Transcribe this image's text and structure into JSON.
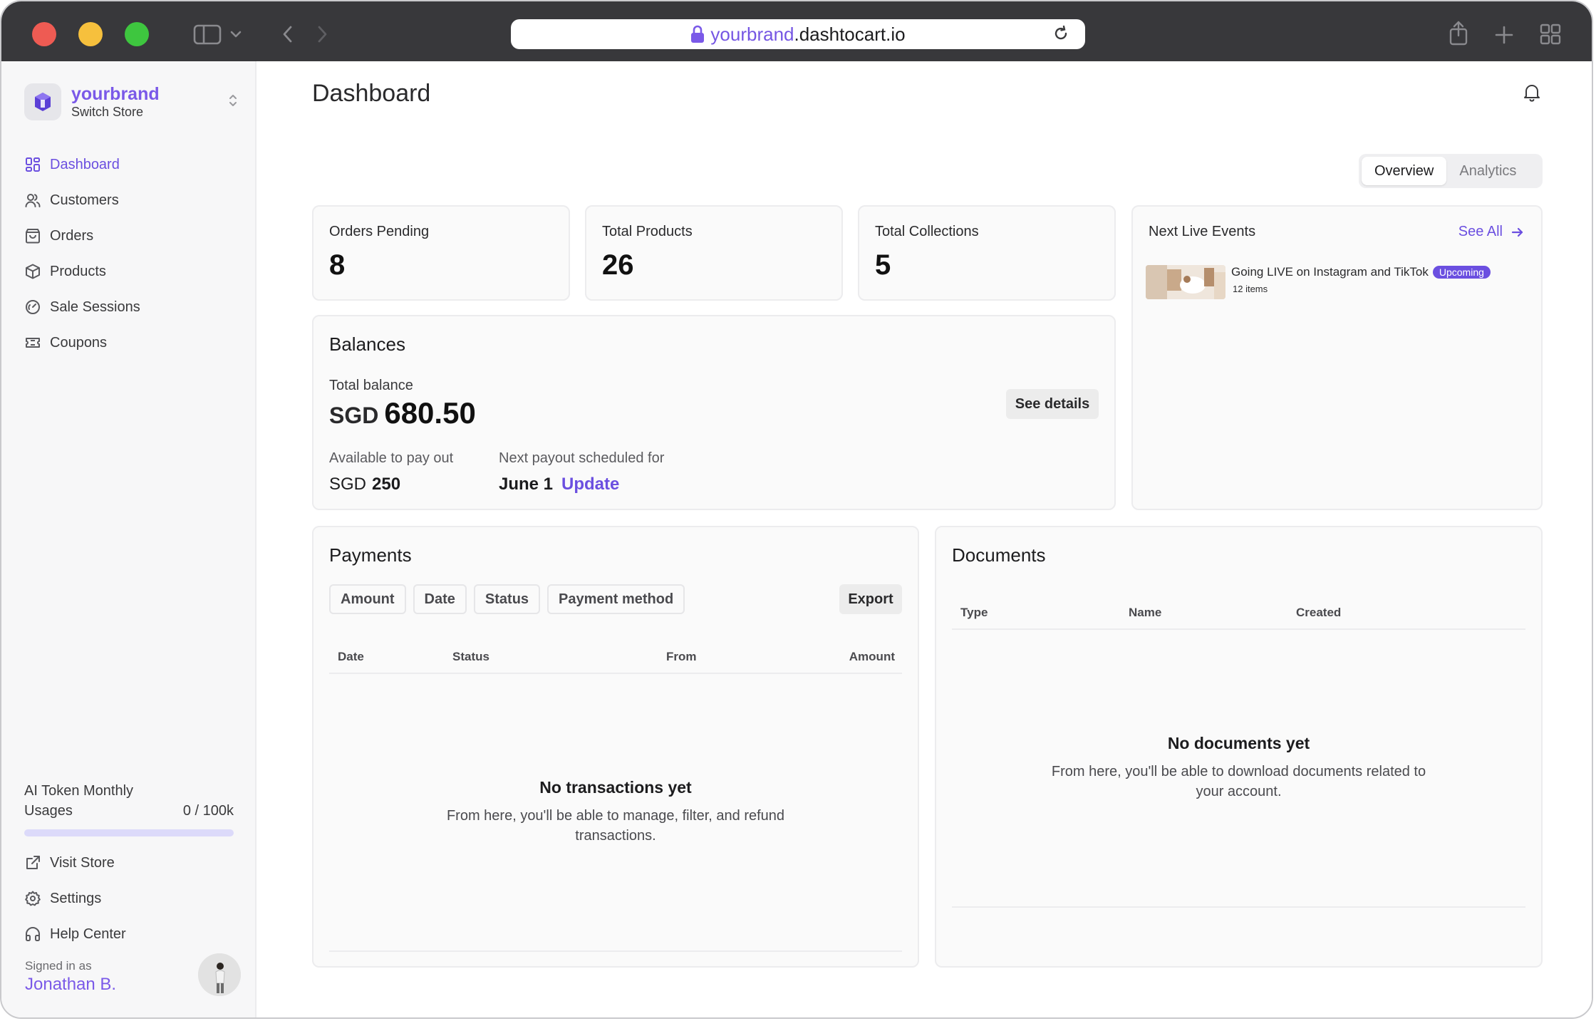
{
  "browser": {
    "url_subdomain": "yourbrand",
    "url_domain": ".dashtocart.io"
  },
  "sidebar": {
    "store_name": "yourbrand",
    "store_switch_label": "Switch Store",
    "nav": [
      {
        "label": "Dashboard",
        "icon": "dashboard-grid-icon",
        "active": true
      },
      {
        "label": "Customers",
        "icon": "users-icon"
      },
      {
        "label": "Orders",
        "icon": "shopping-bag-icon"
      },
      {
        "label": "Products",
        "icon": "box-icon"
      },
      {
        "label": "Sale Sessions",
        "icon": "gauge-icon"
      },
      {
        "label": "Coupons",
        "icon": "ticket-icon"
      }
    ],
    "token_usage": {
      "label": "AI Token Monthly Usages",
      "value": "0 / 100k",
      "fraction_used": 0
    },
    "bottom_nav": [
      {
        "label": "Visit Store",
        "icon": "external-link-icon"
      },
      {
        "label": "Settings",
        "icon": "gear-icon"
      },
      {
        "label": "Help Center",
        "icon": "headphones-icon"
      }
    ],
    "signed_in_label": "Signed in as",
    "user_name": "Jonathan B."
  },
  "main": {
    "title": "Dashboard",
    "tabs": [
      {
        "label": "Overview",
        "active": true
      },
      {
        "label": "Analytics",
        "active": false
      }
    ],
    "stats": [
      {
        "label": "Orders Pending",
        "value": "8"
      },
      {
        "label": "Total Products",
        "value": "26"
      },
      {
        "label": "Total Collections",
        "value": "5"
      }
    ],
    "live_events": {
      "title": "Next Live Events",
      "see_all": "See All",
      "items": [
        {
          "title": "Going LIVE on Instagram and TikTok",
          "badge": "Upcoming",
          "count": "12 items"
        }
      ]
    },
    "balances": {
      "title": "Balances",
      "total_label": "Total balance",
      "currency": "SGD",
      "total_amount": "680.50",
      "see_details": "See details",
      "available_label": "Available to pay out",
      "available_currency": "SGD",
      "available_amount": "250",
      "payout_label": "Next payout scheduled for",
      "payout_date": "June 1",
      "update_link": "Update"
    },
    "payments": {
      "title": "Payments",
      "filters": [
        "Amount",
        "Date",
        "Status",
        "Payment method"
      ],
      "export": "Export",
      "columns": [
        "Date",
        "Status",
        "From",
        "Amount"
      ],
      "empty_title": "No transactions yet",
      "empty_body": "From here, you'll be able to manage, filter, and refund transactions."
    },
    "documents": {
      "title": "Documents",
      "columns": [
        "Type",
        "Name",
        "Created"
      ],
      "empty_title": "No documents yet",
      "empty_body": "From here, you'll be able to download documents related to your account."
    }
  },
  "colors": {
    "accent": "#6b4fe0",
    "brand": "#7a59e8",
    "titlebar": "#38383b"
  }
}
